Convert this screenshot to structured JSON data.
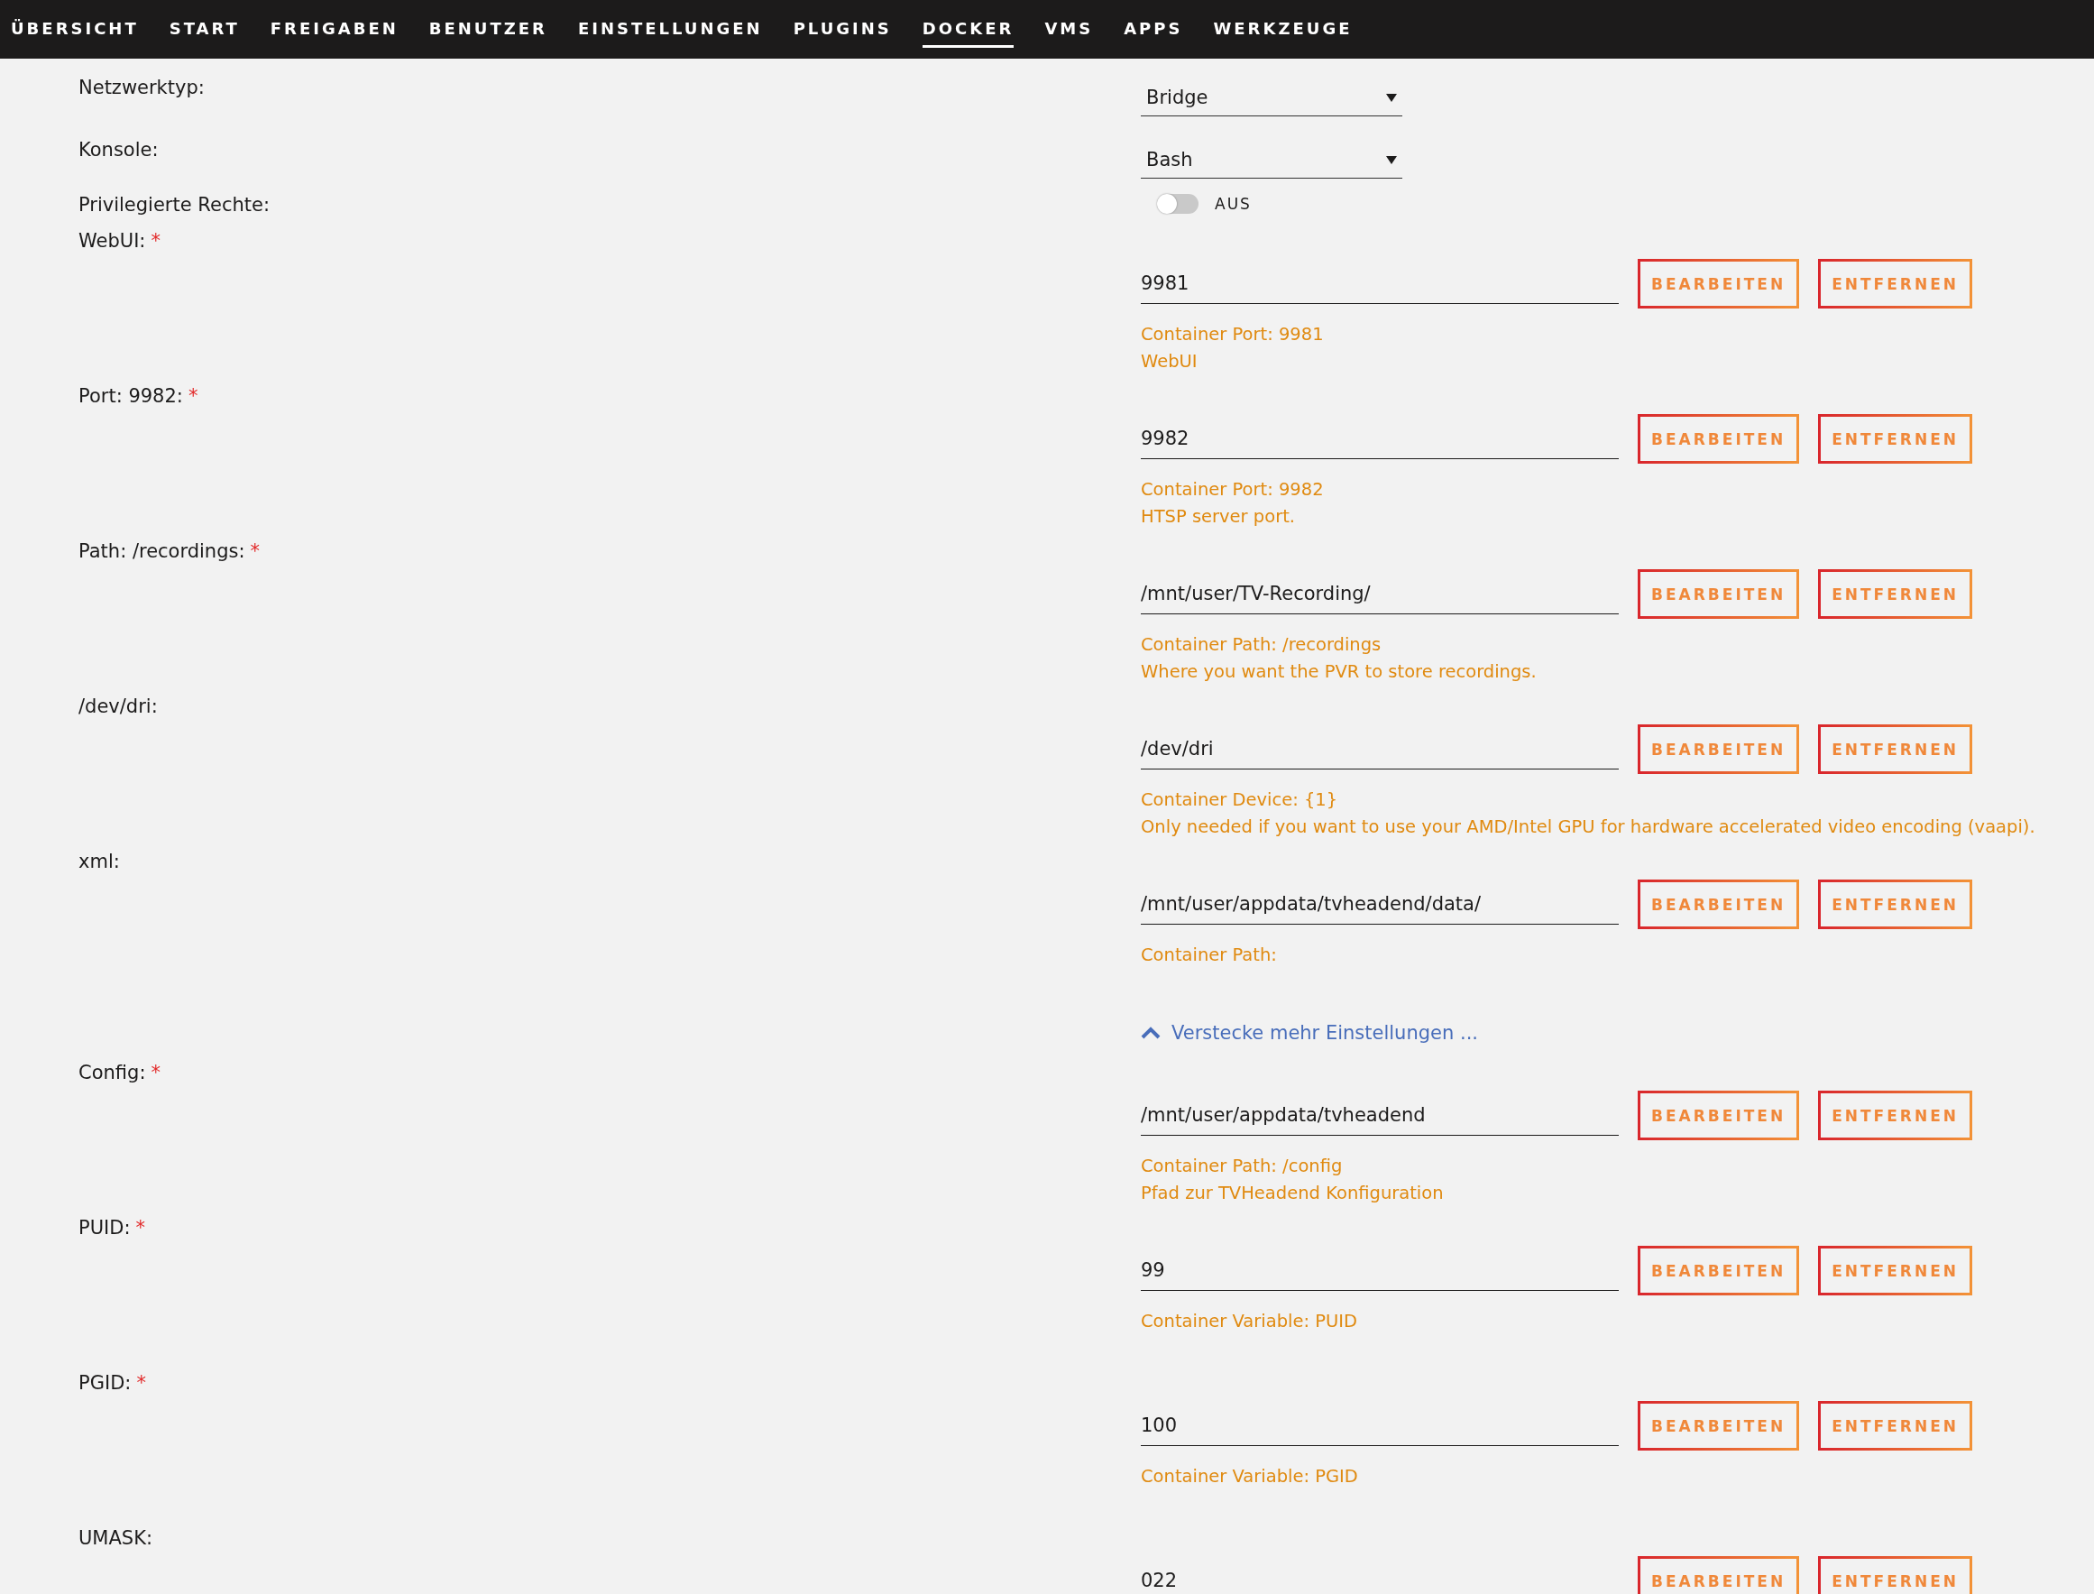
{
  "nav": [
    {
      "label": "ÜBERSICHT",
      "selected": false
    },
    {
      "label": "START",
      "selected": false
    },
    {
      "label": "FREIGABEN",
      "selected": false
    },
    {
      "label": "BENUTZER",
      "selected": false
    },
    {
      "label": "EINSTELLUNGEN",
      "selected": false
    },
    {
      "label": "PLUGINS",
      "selected": false
    },
    {
      "label": "DOCKER",
      "selected": true
    },
    {
      "label": "VMS",
      "selected": false
    },
    {
      "label": "APPS",
      "selected": false
    },
    {
      "label": "WERKZEUGE",
      "selected": false
    }
  ],
  "rows": [
    {
      "kind": "select",
      "label": "Netzwerktyp:",
      "value": "Bridge"
    },
    {
      "kind": "select",
      "label": "Konsole:",
      "value": "Bash"
    },
    {
      "kind": "toggle",
      "label": "Privilegierte Rechte:",
      "on": false,
      "state_text": "AUS"
    },
    {
      "kind": "param",
      "label": "WebUI:",
      "required_mark": "*",
      "value": "9981",
      "description": [
        "Container Port: 9981",
        "WebUI"
      ],
      "edit": "BEARBEITEN",
      "remove": "ENTFERNEN"
    },
    {
      "kind": "param",
      "label": "Port: 9982:",
      "required_mark": "*",
      "value": "9982",
      "description": [
        "Container Port: 9982",
        "HTSP server port."
      ],
      "edit": "BEARBEITEN",
      "remove": "ENTFERNEN"
    },
    {
      "kind": "param",
      "label": "Path: /recordings:",
      "required_mark": "*",
      "value": "/mnt/user/TV-Recording/",
      "description": [
        "Container Path: /recordings",
        "Where you want the PVR to store recordings."
      ],
      "edit": "BEARBEITEN",
      "remove": "ENTFERNEN"
    },
    {
      "kind": "param",
      "label": "/dev/dri:",
      "value": "/dev/dri",
      "description": [
        "Container Device: {1}",
        "Only needed if you want to use your AMD/Intel GPU for hardware accelerated video encoding (vaapi)."
      ],
      "edit": "BEARBEITEN",
      "remove": "ENTFERNEN"
    },
    {
      "kind": "param",
      "label": "xml:",
      "value": "/mnt/user/appdata/tvheadend/data/",
      "description": [
        "Container Path:"
      ],
      "edit": "BEARBEITEN",
      "remove": "ENTFERNEN"
    },
    {
      "kind": "link",
      "label": "Verstecke mehr Einstellungen ...",
      "expanded": true
    },
    {
      "kind": "param",
      "label": "Config:",
      "required_mark": "*",
      "value": "/mnt/user/appdata/tvheadend",
      "description": [
        "Container Path: /config",
        "Pfad zur TVHeadend Konfiguration"
      ],
      "edit": "BEARBEITEN",
      "remove": "ENTFERNEN"
    },
    {
      "kind": "param",
      "label": "PUID:",
      "required_mark": "*",
      "value": "99",
      "description": [
        "Container Variable: PUID"
      ],
      "edit": "BEARBEITEN",
      "remove": "ENTFERNEN"
    },
    {
      "kind": "param",
      "label": "PGID:",
      "required_mark": "*",
      "value": "100",
      "description": [
        "Container Variable: PGID"
      ],
      "edit": "BEARBEITEN",
      "remove": "ENTFERNEN"
    },
    {
      "kind": "param",
      "label": "UMASK:",
      "value": "022",
      "description": [],
      "edit": "BEARBEITEN",
      "remove": "ENTFERNEN"
    }
  ]
}
